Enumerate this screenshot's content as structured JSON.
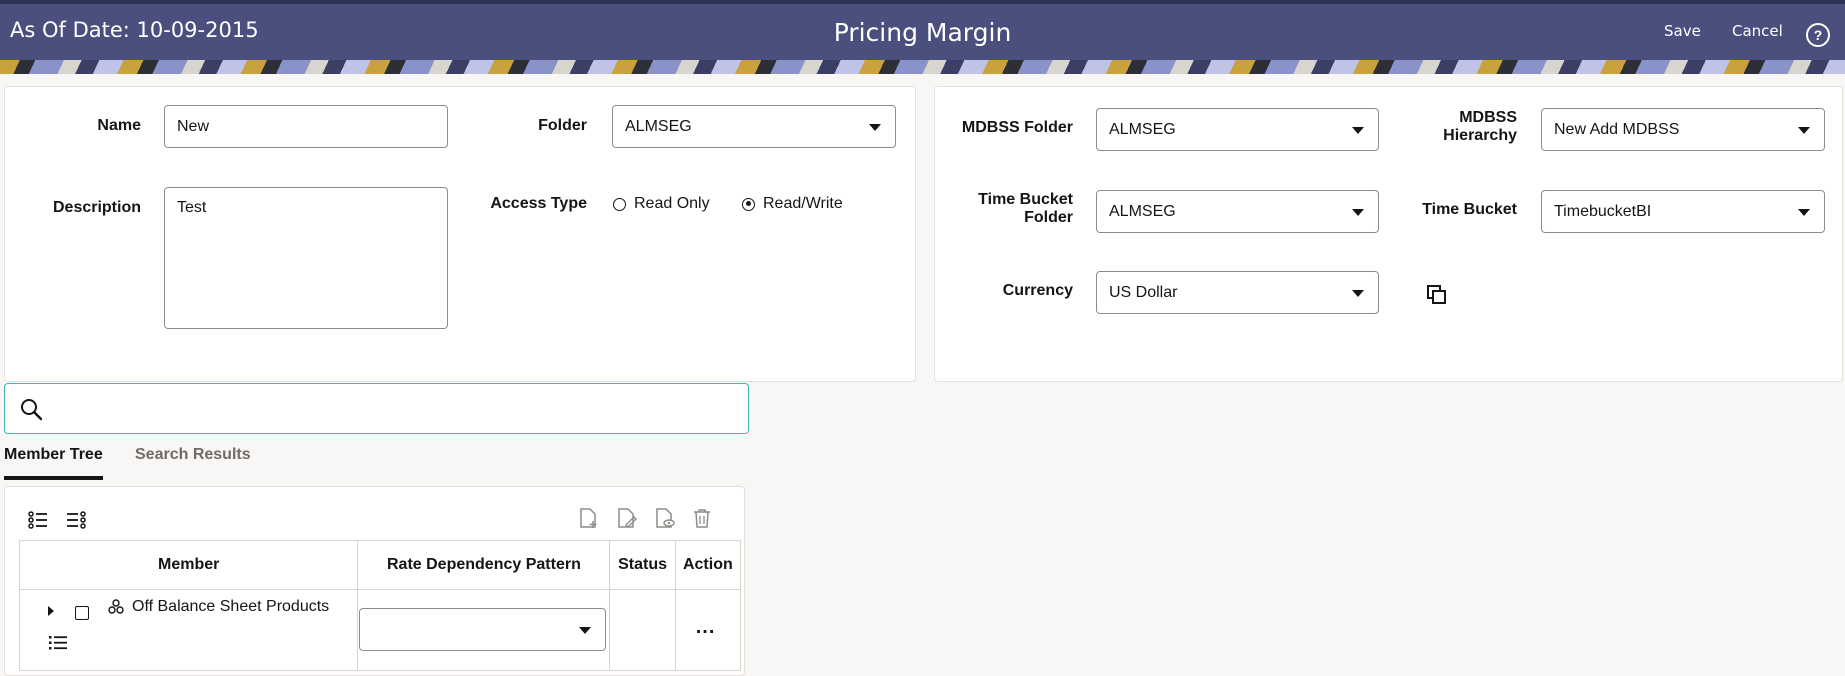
{
  "header": {
    "as_of": "As Of Date: 10-09-2015",
    "title": "Pricing Margin",
    "save_label": "Save",
    "cancel_label": "Cancel",
    "help_glyph": "?"
  },
  "form": {
    "name_label": "Name",
    "name_value": "New",
    "folder_label": "Folder",
    "folder_value": "ALMSEG",
    "description_label": "Description",
    "description_value": "Test",
    "access_type_label": "Access Type",
    "access_options": [
      "Read Only",
      "Read/Write"
    ],
    "access_selected": "Read/Write"
  },
  "right_form": {
    "mdbss_folder_label": "MDBSS Folder",
    "mdbss_folder_value": "ALMSEG",
    "mdbss_hierarchy_label_1": "MDBSS",
    "mdbss_hierarchy_label_2": "Hierarchy",
    "mdbss_hierarchy_value": "New Add MDBSS",
    "time_bucket_folder_label_1": "Time Bucket",
    "time_bucket_folder_label_2": "Folder",
    "time_bucket_folder_value": "ALMSEG",
    "time_bucket_label": "Time Bucket",
    "time_bucket_value": "TimebucketBI",
    "currency_label": "Currency",
    "currency_value": "US Dollar"
  },
  "search": {
    "placeholder": ""
  },
  "tabs": [
    {
      "label": "Member Tree",
      "active": true
    },
    {
      "label": "Search Results",
      "active": false
    }
  ],
  "grid": {
    "columns": [
      "Member",
      "Rate Dependency Pattern",
      "Status",
      "Action"
    ],
    "rows": [
      {
        "member": "Off Balance Sheet Products",
        "pattern": "",
        "status": "",
        "action": "..."
      }
    ]
  },
  "icons": [
    "help-icon",
    "copy-icon",
    "search-icon",
    "expand-all-icon",
    "collapse-all-icon",
    "add-file-icon",
    "edit-file-icon",
    "view-file-icon",
    "delete-icon",
    "tree-node-icon",
    "list-icon"
  ],
  "colors": {
    "header_bg": "#4a4f7e",
    "search_border": "#3fb8b0"
  }
}
